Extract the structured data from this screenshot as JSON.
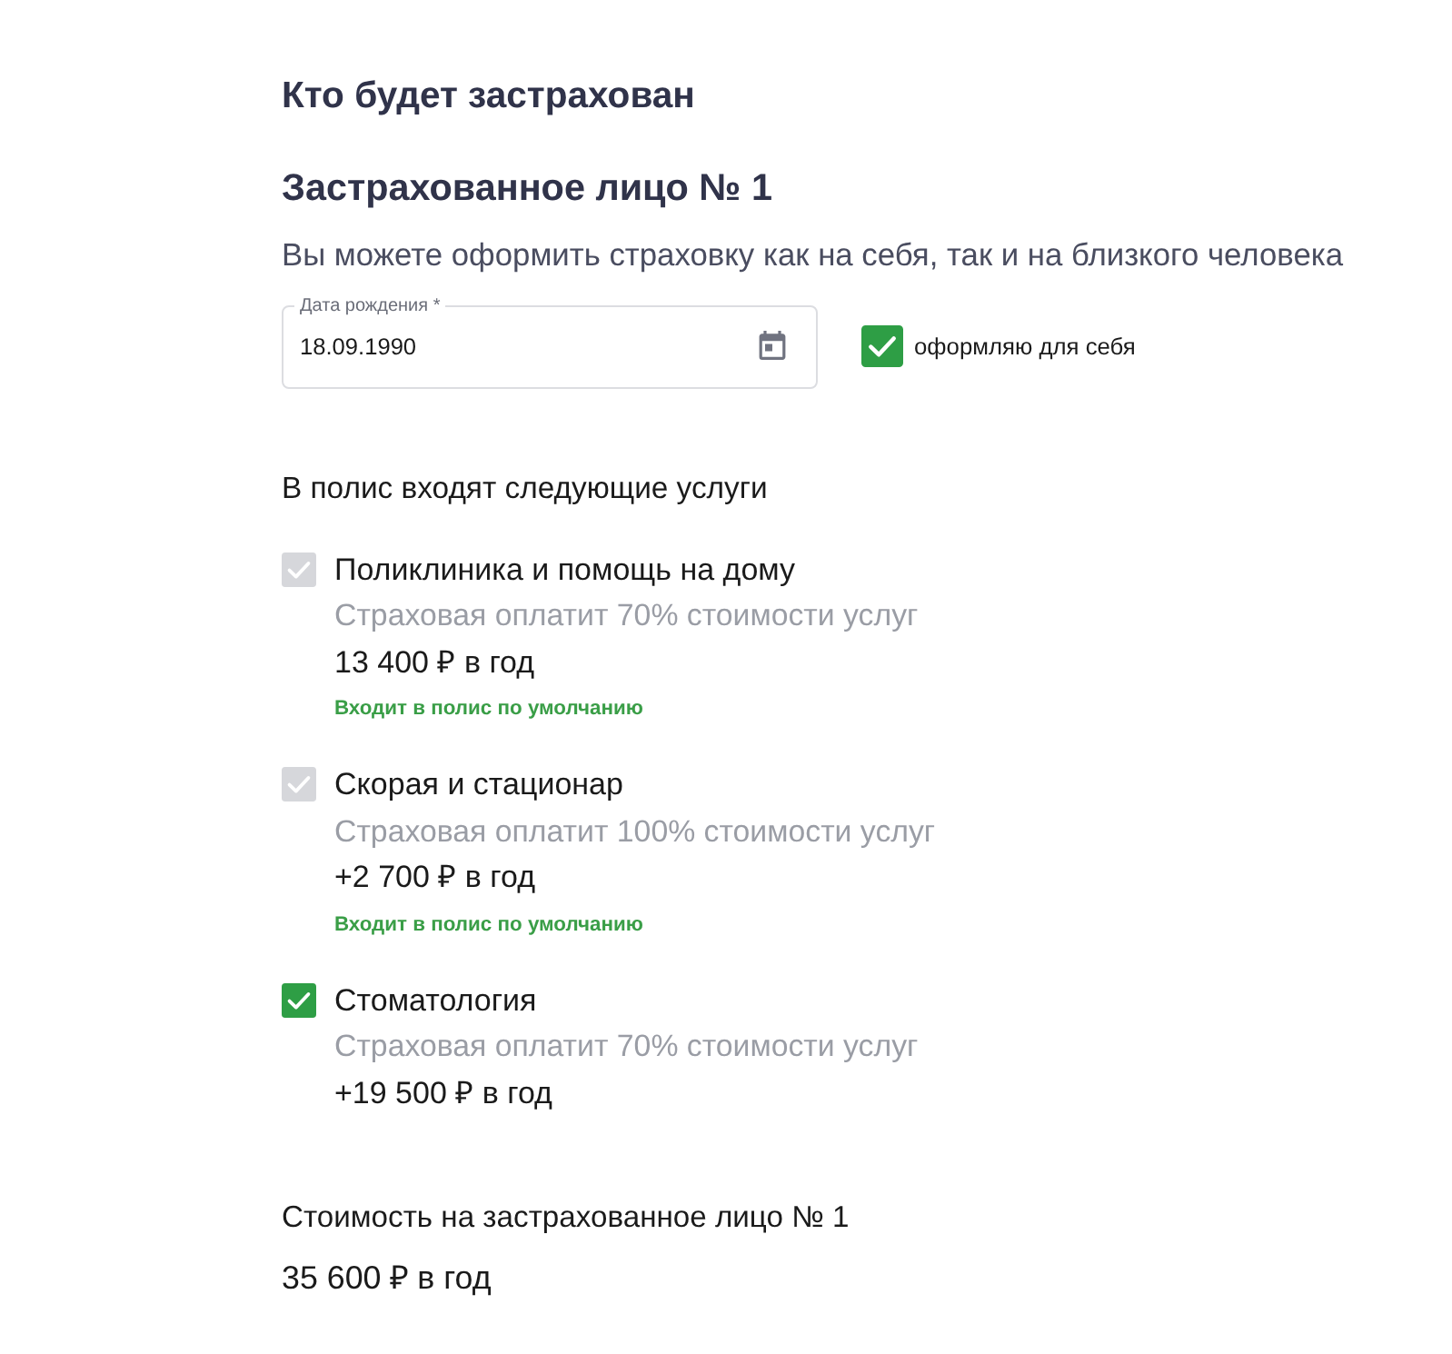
{
  "section_title": "Кто будет застрахован",
  "insured": {
    "title": "Застрахованное лицо № 1",
    "description": "Вы можете оформить страховку как на себя, так и на близкого человека",
    "birth_date": {
      "label": "Дата рождения *",
      "value": "18.09.1990"
    },
    "for_self": {
      "label": "оформляю для себя",
      "checked": true
    }
  },
  "services": {
    "heading": "В полис входят следующие услуги",
    "items": [
      {
        "name": "Поликлиника и помощь на дому",
        "coverage": "Страховая оплатит 70% стоимости услуг",
        "price": "13 400 ₽ в год",
        "note": "Входит в полис по умолчанию",
        "checked": true,
        "disabled": true
      },
      {
        "name": "Скорая и стационар",
        "coverage": "Страховая оплатит 100% стоимости услуг",
        "price": "+2 700 ₽ в год",
        "note": "Входит в полис по умолчанию",
        "checked": true,
        "disabled": true
      },
      {
        "name": "Стоматология",
        "coverage": "Страховая оплатит 70% стоимости услуг",
        "price": "+19 500 ₽ в год",
        "checked": true,
        "disabled": false
      }
    ]
  },
  "total": {
    "label": "Стоимость на застрахованное лицо № 1",
    "value": "35 600 ₽ в год"
  }
}
